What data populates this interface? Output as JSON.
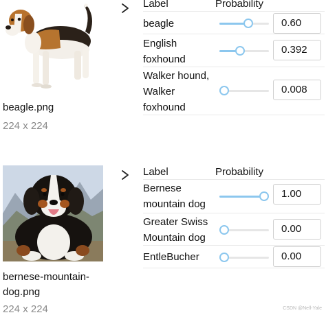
{
  "results": [
    {
      "filename": "beagle.png",
      "dimensions": "224 x 224",
      "image": "beagle-dog-photo",
      "columns": {
        "label": "Label",
        "probability": "Probability"
      },
      "rows": [
        {
          "label": "beagle",
          "value": "0.60",
          "probability": 0.6
        },
        {
          "label": "English foxhound",
          "value": "0.392",
          "probability": 0.392
        },
        {
          "label": "Walker hound, Walker foxhound",
          "value": "0.008",
          "probability": 0.008
        }
      ]
    },
    {
      "filename": "bernese-mountain-dog.png",
      "dimensions": "224 x 224",
      "image": "bernese-mountain-dog-photo",
      "columns": {
        "label": "Label",
        "probability": "Probability"
      },
      "rows": [
        {
          "label": "Bernese mountain dog",
          "value": "1.00",
          "probability": 1.0
        },
        {
          "label": "Greater Swiss Mountain dog",
          "value": "0.00",
          "probability": 0.0
        },
        {
          "label": "EntleBucher",
          "value": "0.00",
          "probability": 0.0
        }
      ]
    }
  ],
  "colors": {
    "accent": "#8cc7ee",
    "track": "#e6e6e6",
    "muted_text": "#8a8a8a"
  },
  "icons": {
    "expand": "chevron-right-icon"
  },
  "watermark": "CSDN @Nell-Yale"
}
